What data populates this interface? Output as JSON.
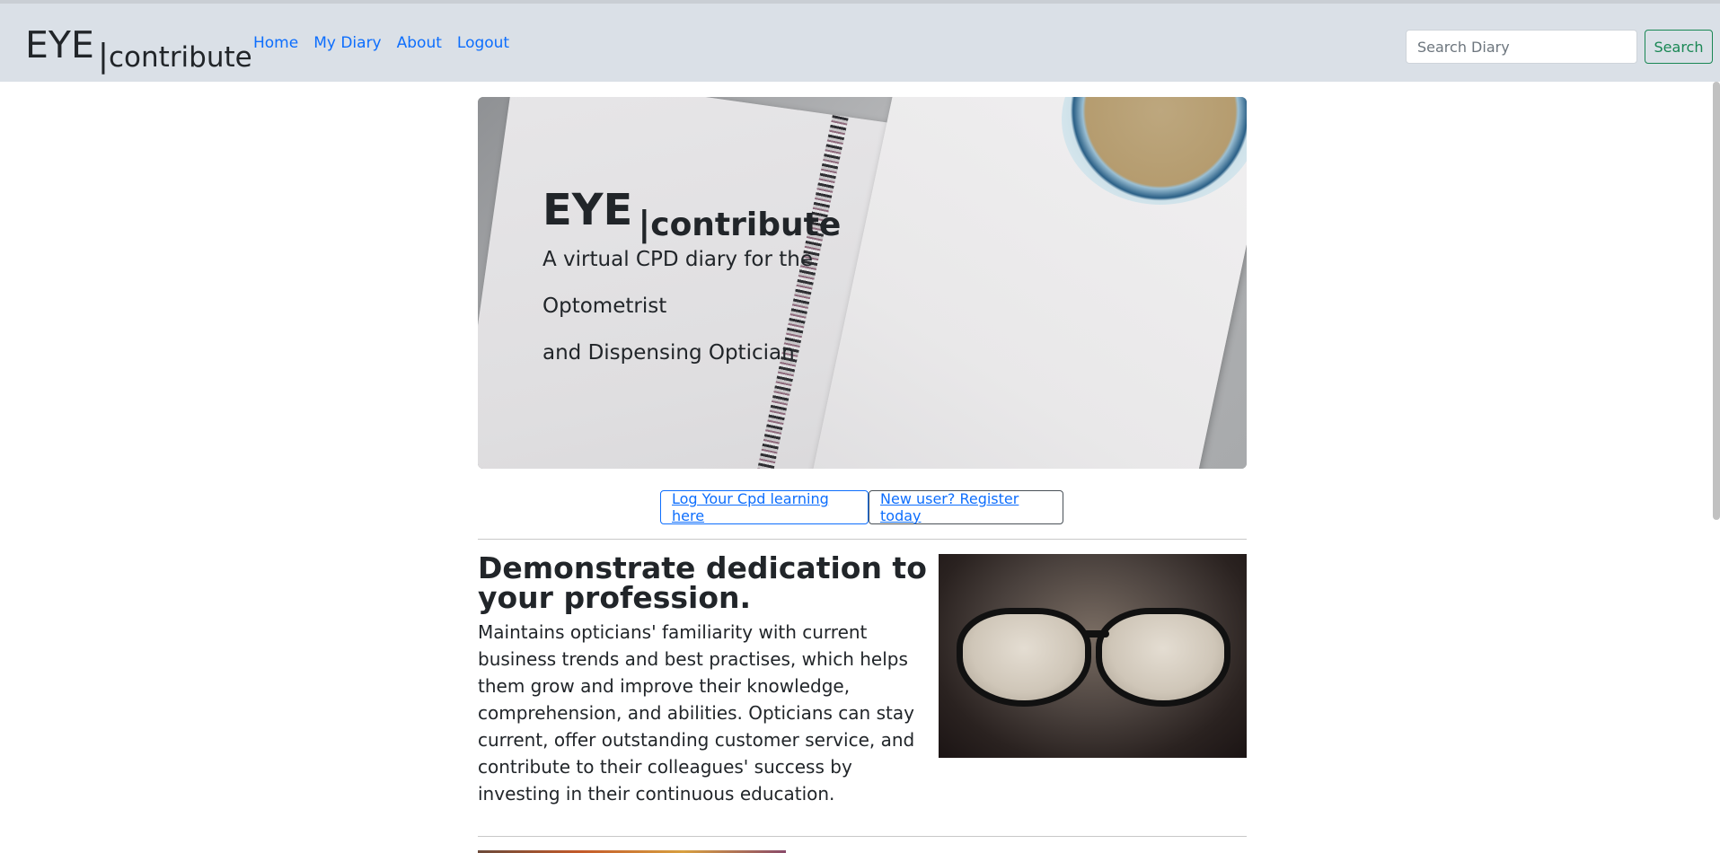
{
  "navbar": {
    "brand_main": "EYE",
    "brand_bar": "|",
    "brand_sub": "contribute",
    "links": [
      "Home",
      "My Diary",
      "About",
      "Logout"
    ],
    "search_placeholder": "Search Diary",
    "search_button": "Search"
  },
  "hero": {
    "title_main": "EYE",
    "title_bar": "|",
    "title_sub": "contribute",
    "line1": "A virtual CPD diary for the",
    "line2": "Optometrist",
    "line3": "and Dispensing Optician"
  },
  "actions": {
    "log_button": "Log Your Cpd learning here",
    "register_button": "New user? Register today"
  },
  "section": {
    "title": "Demonstrate dedication to your profession.",
    "body": "Maintains opticians' familiarity with current business trends and best practises, which helps them grow and improve their knowledge, comprehension, and abilities. Opticians can stay current, offer outstanding customer service, and contribute to their colleagues' success by investing in their continuous education."
  },
  "colors": {
    "navbar_bg": "#dae0e7",
    "link": "#0d6efd",
    "search_button": "#198754"
  }
}
